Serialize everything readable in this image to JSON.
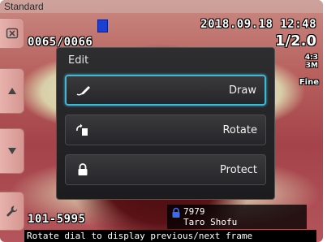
{
  "overlay": {
    "mode_badge": "Standard",
    "datetime": "2018.09.18 12:48",
    "frame_counter": "0065/0066",
    "magnification": "1/2.0",
    "aspect": "4:3",
    "resolution": "3M",
    "quality": "Fine",
    "patient_id": "101-5995"
  },
  "patient": {
    "number": "7979",
    "name": "Taro Shofu"
  },
  "status_bar": "Rotate dial to display previous/next frame",
  "edit_menu": {
    "title": "Edit",
    "items": [
      {
        "label": "Draw",
        "icon": "pen-icon",
        "selected": true
      },
      {
        "label": "Rotate",
        "icon": "rotate-icon",
        "selected": false
      },
      {
        "label": "Protect",
        "icon": "lock-icon",
        "selected": false
      }
    ]
  },
  "colors": {
    "selection_accent": "#3fb7d6",
    "flag_blue": "#1a3fd4"
  }
}
